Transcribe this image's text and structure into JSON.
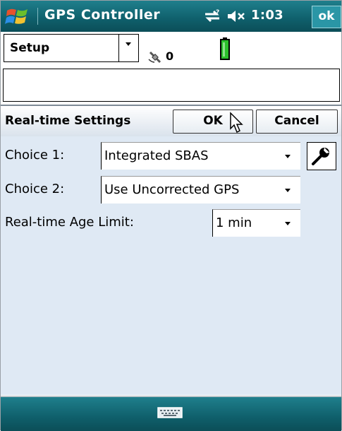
{
  "titlebar": {
    "app_title": "GPS Controller",
    "clock": "1:03",
    "ok_label": "ok",
    "icons": [
      "windows-logo-icon",
      "connectivity-icon",
      "volume-muted-icon"
    ]
  },
  "toolbar": {
    "menu_label": "Setup",
    "satellite_count": "0",
    "icons": [
      "satellite-icon",
      "battery-icon"
    ]
  },
  "message_field": {
    "value": ""
  },
  "settings": {
    "title": "Real-time Settings",
    "ok_label": "OK",
    "cancel_label": "Cancel"
  },
  "form": {
    "choice1": {
      "label": "Choice 1:",
      "value": "Integrated SBAS"
    },
    "choice2": {
      "label": "Choice 2:",
      "value": "Use Uncorrected GPS"
    },
    "age_limit": {
      "label": "Real-time Age Limit:",
      "value": "1 min"
    }
  },
  "taskbar": {
    "icons": [
      "keyboard-icon"
    ]
  },
  "colors": {
    "titlebar": "#0f5f6b",
    "form_background": "#dfe9f4",
    "battery": "#2bbf2b"
  }
}
